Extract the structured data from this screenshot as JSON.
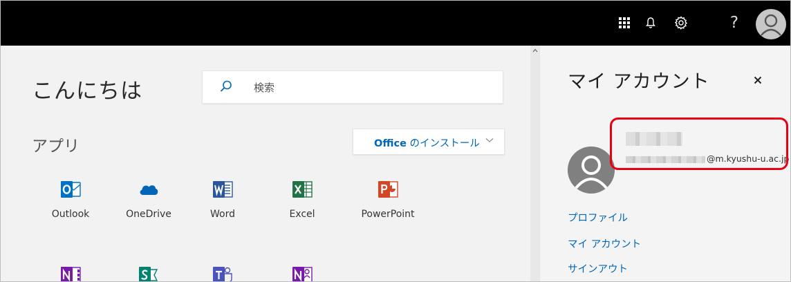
{
  "topbar": {
    "icons": [
      "app-launcher-icon",
      "notification-bell-icon",
      "settings-gear-icon",
      "help-icon",
      "user-avatar-icon"
    ],
    "help_label": "?",
    "background": "#000000"
  },
  "main": {
    "greeting": "こんにちは",
    "search": {
      "label": "検索",
      "icon": "search-icon"
    },
    "apps_heading": "アプリ",
    "install_button": {
      "brand": "Office",
      "label": " のインストール",
      "icon": "chevron-down-icon"
    },
    "apps": [
      {
        "name": "Outlook",
        "icon": "outlook-icon",
        "color": "#0072c6"
      },
      {
        "name": "OneDrive",
        "icon": "onedrive-icon",
        "color": "#0364b8"
      },
      {
        "name": "Word",
        "icon": "word-icon",
        "color": "#2b579a"
      },
      {
        "name": "Excel",
        "icon": "excel-icon",
        "color": "#217346"
      },
      {
        "name": "PowerPoint",
        "icon": "powerpoint-icon",
        "color": "#d24726"
      },
      {
        "name": "",
        "icon": "onenote-icon",
        "color": "#7719aa"
      },
      {
        "name": "",
        "icon": "sway-icon",
        "color": "#008272"
      },
      {
        "name": "",
        "icon": "teams-icon",
        "color": "#4b53bc"
      },
      {
        "name": "",
        "icon": "onenote-class-notebook-icon",
        "color": "#7719aa"
      }
    ]
  },
  "account_panel": {
    "title": "マイ アカウント",
    "close_icon": "close-icon",
    "email_domain": "@m.kyushu-u.ac.jp",
    "highlight_color": "#e60012",
    "links": [
      "プロファイル",
      "マイ アカウント",
      "サインアウト"
    ],
    "link_color": "#0067b8"
  }
}
